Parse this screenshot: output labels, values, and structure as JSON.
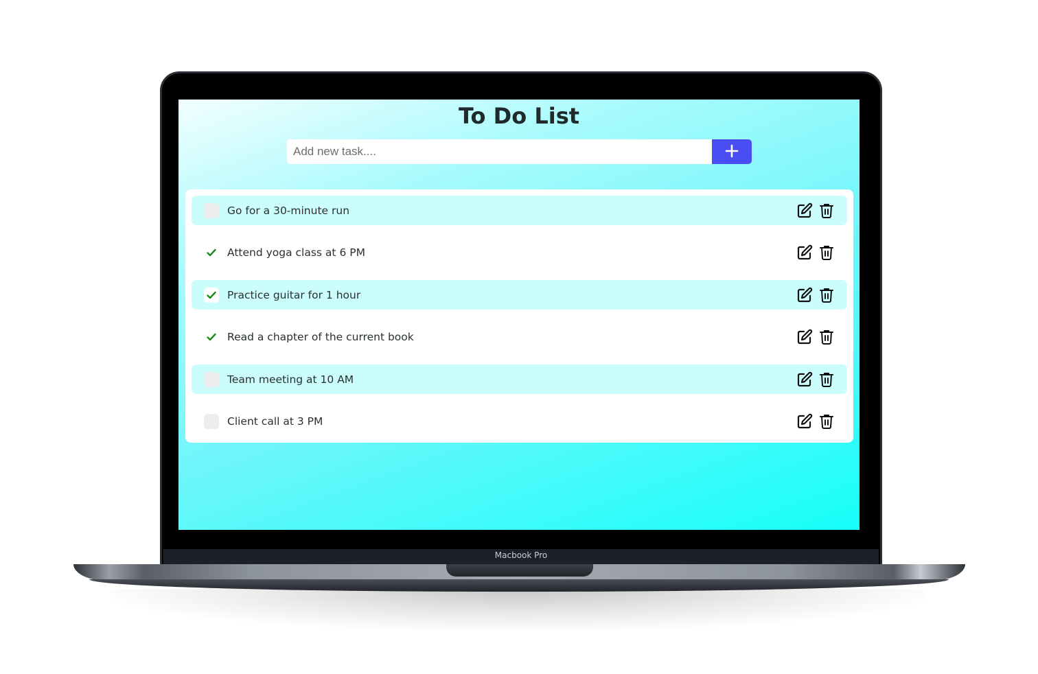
{
  "app": {
    "title": "To Do List",
    "input_placeholder": "Add new task....",
    "add_button_icon": "plus-icon"
  },
  "tasks": [
    {
      "label": "Go for a 30-minute run",
      "done": false
    },
    {
      "label": "Attend yoga class at 6 PM",
      "done": true
    },
    {
      "label": "Practice guitar for 1 hour",
      "done": true
    },
    {
      "label": "Read a chapter of the current book",
      "done": true
    },
    {
      "label": "Team meeting at 10 AM",
      "done": false
    },
    {
      "label": "Client call at 3 PM",
      "done": false
    }
  ],
  "task_actions": [
    "edit-icon",
    "trash-icon"
  ],
  "device": {
    "label": "Macbook Pro"
  },
  "colors": {
    "accent": "#4a4df2",
    "check": "#1a8a1a",
    "row_highlight": "#ccfdfd",
    "background_gradient_end": "#16fff9"
  }
}
